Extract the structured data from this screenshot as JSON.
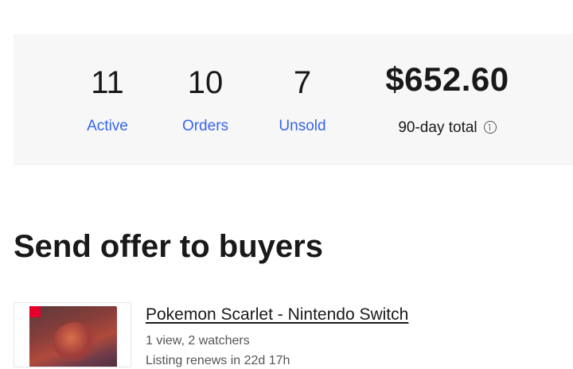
{
  "stats": {
    "active": {
      "value": "11",
      "label": "Active"
    },
    "orders": {
      "value": "10",
      "label": "Orders"
    },
    "unsold": {
      "value": "7",
      "label": "Unsold"
    },
    "total": {
      "value": "$652.60",
      "label": "90-day total",
      "icon": "info-icon"
    }
  },
  "section": {
    "title": "Send offer to buyers"
  },
  "item": {
    "title": "Pokemon Scarlet - Nintendo Switch",
    "views_watchers": "1 view, 2 watchers",
    "renewal": "Listing renews in 22d 17h",
    "image_icon": "product-thumbnail"
  },
  "colors": {
    "link": "#3665f3",
    "panel_bg": "#f7f7f7",
    "text": "#191919"
  }
}
